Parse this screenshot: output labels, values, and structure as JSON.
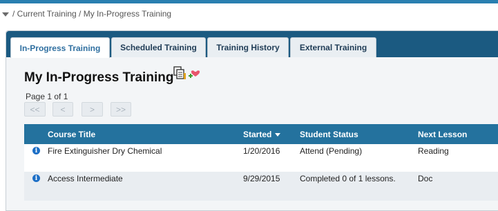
{
  "breadcrumb": {
    "text": "/ Current Training / My In-Progress Training"
  },
  "tabs": [
    {
      "label": "In-Progress Training",
      "active": true
    },
    {
      "label": "Scheduled Training",
      "active": false
    },
    {
      "label": "Training History",
      "active": false
    },
    {
      "label": "External Training",
      "active": false
    }
  ],
  "page": {
    "title": "My In-Progress Training"
  },
  "pager": {
    "info": "Page 1 of 1",
    "first": "<<",
    "prev": "<",
    "next": ">",
    "last": ">>"
  },
  "table": {
    "headers": [
      "Course Title",
      "Started",
      "Student Status",
      "Next Lesson"
    ],
    "sorted_column": "Started",
    "rows": [
      {
        "course": "Fire Extinguisher Dry Chemical",
        "started": "1/20/2016",
        "status": "Attend (Pending)",
        "next": "Reading"
      },
      {
        "course": "Access Intermediate",
        "started": "9/29/2015",
        "status": "Completed 0 of 1 lessons.",
        "next": "Doc"
      }
    ]
  },
  "icons": {
    "copy_icon": "documents-icon",
    "add_favorite_icon": "plus-heart-icon",
    "info_icon": "info-circle-icon",
    "breadcrumb_toggle": "triangle-down-icon"
  },
  "colors": {
    "tab_bar": "#1b5a81",
    "table_header": "#24729e",
    "top_border": "#2a7fb0"
  }
}
